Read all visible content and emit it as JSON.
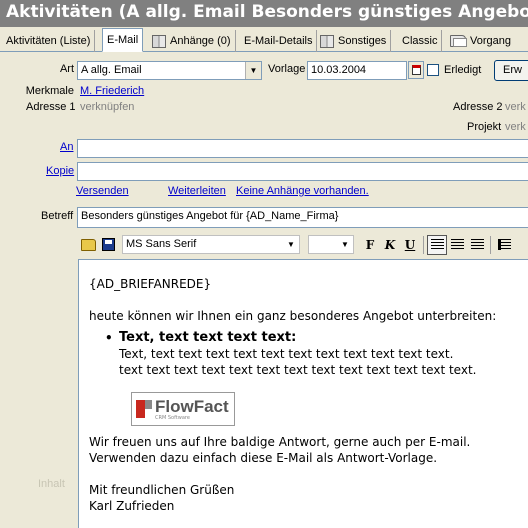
{
  "window": {
    "title": "Aktivitäten (A allg. Email Besonders günstiges Angebot für"
  },
  "tabs": [
    {
      "label": "Aktivitäten (Liste)",
      "icon": ""
    },
    {
      "label": "E-Mail",
      "icon": ""
    },
    {
      "label": "Anhänge (0)",
      "icon": "book-icon"
    },
    {
      "label": "E-Mail-Details",
      "icon": ""
    },
    {
      "label": "Sonstiges",
      "icon": "book-icon"
    },
    {
      "label": "Classic",
      "icon": ""
    },
    {
      "label": "Vorgang",
      "icon": "folder-icon"
    }
  ],
  "form": {
    "art_label": "Art",
    "art_value": "A allg. Email",
    "vorlage_label": "Vorlage",
    "vorlage_value": "10.03.2004",
    "erledigt_label": "Erledigt",
    "erw_button": "Erw",
    "merkmale_label": "Merkmale",
    "merkmale_value": "M. Friederich",
    "adresse1_label": "Adresse 1",
    "adresse1_value": "verknüpfen",
    "adresse2_label": "Adresse 2",
    "adresse2_value": "verk",
    "projekt_label": "Projekt",
    "projekt_value": "verk",
    "an_label": "An",
    "kopie_label": "Kopie",
    "versenden": "Versenden",
    "weiterleiten": "Weiterleiten",
    "anhaenge_link": "Keine Anhänge vorhanden.",
    "betreff_label": "Betreff",
    "betreff_value": "Besonders günstiges Angebot für {AD_Name_Firma}",
    "side_label": "Inhalt"
  },
  "toolbar": {
    "font": "MS Sans Serif",
    "size": "",
    "bold": "F",
    "italic": "K",
    "underline": "U"
  },
  "editor": {
    "salutation": "{AD_BRIEFANREDE}",
    "intro": "heute können wir Ihnen ein ganz besonderes Angebot unterbreiten:",
    "bullet_title": "Text, text text text text:",
    "bullet_line1": "Text, text text text text text text text text text text text.",
    "bullet_line2": "text text text text text text text text text text text text text.",
    "logo_text": "FlowFact",
    "logo_sub": "CRM Software",
    "closing1": "Wir freuen uns auf Ihre baldige Antwort, gerne auch per E-mail.",
    "closing2": "Verwenden dazu einfach diese E-Mail als Antwort-Vorlage.",
    "greeting": "Mit freundlichen Grüßen",
    "signature": "Karl Zufrieden"
  }
}
